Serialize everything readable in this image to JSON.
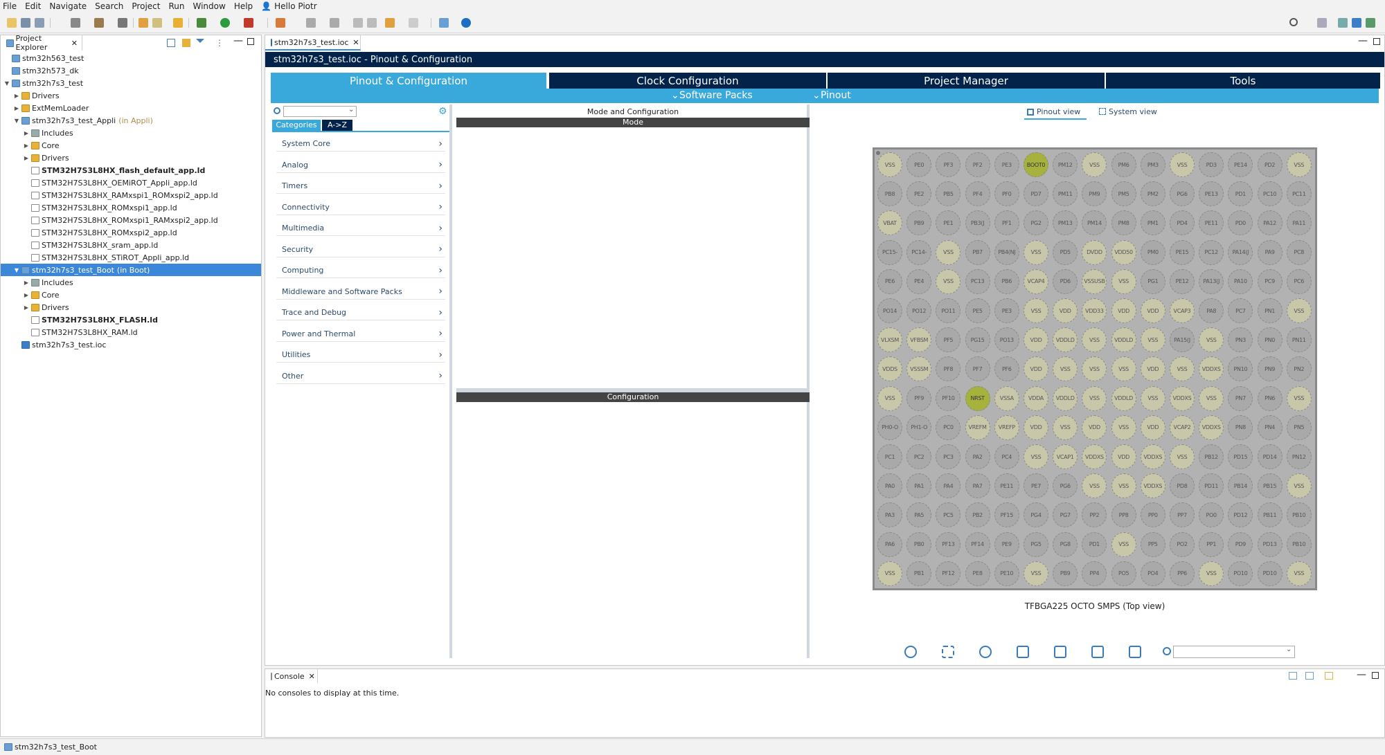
{
  "menu": [
    "File",
    "Edit",
    "Navigate",
    "Search",
    "Project",
    "Run",
    "Window",
    "Help",
    "Hello Piotr"
  ],
  "project_explorer": {
    "tab_label": "Project Explorer",
    "tree": [
      {
        "label": "stm32h563_test",
        "decor": "",
        "bold": false
      },
      {
        "label": "stm32h573_dk",
        "decor": "",
        "bold": false
      },
      {
        "label": "stm32h7s3_test",
        "decor": "",
        "bold": false
      },
      {
        "label": "Drivers",
        "decor": "",
        "bold": false
      },
      {
        "label": "ExtMemLoader",
        "decor": "",
        "bold": false
      },
      {
        "label": "stm32h7s3_test_Appli",
        "decor": "(in Appli)",
        "bold": false
      },
      {
        "label": "Includes",
        "decor": "",
        "bold": false
      },
      {
        "label": "Core",
        "decor": "",
        "bold": false
      },
      {
        "label": "Drivers",
        "decor": "",
        "bold": false
      },
      {
        "label": "STM32H7S3L8HX_flash_default_app.ld",
        "decor": "",
        "bold": true
      },
      {
        "label": "STM32H7S3L8HX_OEMiROT_Appli_app.ld",
        "decor": "",
        "bold": false
      },
      {
        "label": "STM32H7S3L8HX_RAMxspi1_ROMxspi2_app.ld",
        "decor": "",
        "bold": false
      },
      {
        "label": "STM32H7S3L8HX_ROMxspi1_app.ld",
        "decor": "",
        "bold": false
      },
      {
        "label": "STM32H7S3L8HX_ROMxspi1_RAMxspi2_app.ld",
        "decor": "",
        "bold": false
      },
      {
        "label": "STM32H7S3L8HX_ROMxspi2_app.ld",
        "decor": "",
        "bold": false
      },
      {
        "label": "STM32H7S3L8HX_sram_app.ld",
        "decor": "",
        "bold": false
      },
      {
        "label": "STM32H7S3L8HX_STiROT_Appli_app.ld",
        "decor": "",
        "bold": false
      },
      {
        "label": "stm32h7s3_test_Boot",
        "decor": "(in Boot)",
        "bold": false
      },
      {
        "label": "Includes",
        "decor": "",
        "bold": false
      },
      {
        "label": "Core",
        "decor": "",
        "bold": false
      },
      {
        "label": "Drivers",
        "decor": "",
        "bold": false
      },
      {
        "label": "STM32H7S3L8HX_FLASH.ld",
        "decor": "",
        "bold": true
      },
      {
        "label": "STM32H7S3L8HX_RAM.ld",
        "decor": "",
        "bold": false
      },
      {
        "label": "stm32h7s3_test.ioc",
        "decor": "",
        "bold": false
      }
    ]
  },
  "editor": {
    "tab_label": "stm32h7s3_test.ioc",
    "banner": "stm32h7s3_test.ioc - Pinout & Configuration",
    "main_tabs": [
      "Pinout & Configuration",
      "Clock Configuration",
      "Project Manager",
      "Tools"
    ],
    "sub_menus": [
      "Software Packs",
      "Pinout"
    ],
    "cat_tabs": [
      "Categories",
      "A->Z"
    ],
    "categories": [
      "System Core",
      "Analog",
      "Timers",
      "Connectivity",
      "Multimedia",
      "Security",
      "Computing",
      "Middleware and Software Packs",
      "Trace and Debug",
      "Power and Thermal",
      "Utilities",
      "Other"
    ],
    "mode_title": "Mode and Configuration",
    "mode_header": "Mode",
    "config_header": "Configuration",
    "view_tabs": [
      "Pinout view",
      "System view"
    ],
    "package_label": "TFBGA225 OCTO SMPS (Top view)"
  },
  "pins": [
    [
      "VSS",
      "PE0",
      "PF3",
      "PF2",
      "PE3",
      "BOOT0",
      "PM12",
      "VSS",
      "PM6",
      "PM3",
      "VSS",
      "PD3",
      "PE14",
      "PD2",
      "VSS"
    ],
    [
      "PB8",
      "PE2",
      "PB5",
      "PF4",
      "PF0",
      "PD7",
      "PM11",
      "PM9",
      "PM5",
      "PM2",
      "PG6",
      "PE13",
      "PD1",
      "PC10",
      "PC11"
    ],
    [
      "VBAT",
      "PB9",
      "PE1",
      "PB3(J",
      "PF1",
      "PG2",
      "PM13",
      "PM14",
      "PM8",
      "PM1",
      "PD4",
      "PE11",
      "PD0",
      "PA12",
      "PA11"
    ],
    [
      "PC15-",
      "PC14-",
      "VSS",
      "PB7",
      "PB4(NJ",
      "VSS",
      "PD5",
      "DVDD",
      "VDD50",
      "PM0",
      "PE15",
      "PC12",
      "PA14(J",
      "PA9",
      "PC8"
    ],
    [
      "PE6",
      "PE4",
      "VSS",
      "PC13",
      "PB6",
      "VCAP4",
      "PD6",
      "VSSUSB",
      "VSS",
      "PG1",
      "PE12",
      "PA13(J",
      "PA10",
      "PC9",
      "PC6"
    ],
    [
      "PO14",
      "PO12",
      "PO11",
      "PE5",
      "PE3",
      "VSS",
      "VDD",
      "VDD33",
      "VDD",
      "VDD",
      "VCAP3",
      "PA8",
      "PC7",
      "PN1",
      "VSS"
    ],
    [
      "VLXSM",
      "VFBSM",
      "PF5",
      "PG15",
      "PO13",
      "VDD",
      "VDDLD",
      "VSS",
      "VDDLD",
      "VSS",
      "PA15(J",
      "VSS",
      "PN3",
      "PN0",
      "PN11"
    ],
    [
      "VDDS",
      "VSSSM",
      "PF8",
      "PF7",
      "PF6",
      "VDD",
      "VSS",
      "VSS",
      "VSS",
      "VDD",
      "VSS",
      "VDDXS",
      "PN10",
      "PN9",
      "PN2"
    ],
    [
      "VSS",
      "PF9",
      "PF10",
      "NRST",
      "VSSA",
      "VDDA",
      "VDDLD",
      "VSS",
      "VDDLD",
      "VSS",
      "VDDXS",
      "VSS",
      "PN7",
      "PN6",
      "VSS"
    ],
    [
      "PH0-O",
      "PH1-O",
      "PC0",
      "VREFM",
      "VREFP",
      "VDD",
      "VSS",
      "VDD",
      "VSS",
      "VDD",
      "VCAP2",
      "VDDXS",
      "PN8",
      "PN4",
      "PN5"
    ],
    [
      "PC1",
      "PC2",
      "PC3",
      "PA2",
      "PC4",
      "VSS",
      "VCAP1",
      "VDDXS",
      "VDD",
      "VDDXS",
      "VSS",
      "PB12",
      "PD15",
      "PD14",
      "PN12"
    ],
    [
      "PA0",
      "PA1",
      "PA4",
      "PA7",
      "PE11",
      "PE7",
      "PG6",
      "VSS",
      "VSS",
      "VDDXS",
      "PD8",
      "PD11",
      "PB14",
      "PB15",
      "VSS"
    ],
    [
      "PA3",
      "PA5",
      "PC5",
      "PB2",
      "PF15",
      "PG4",
      "PG7",
      "PP2",
      "PP8",
      "PP0",
      "PP7",
      "PO0",
      "PD12",
      "PB11",
      "PB10"
    ],
    [
      "PA6",
      "PB0",
      "PF13",
      "PF14",
      "PE9",
      "PG5",
      "PG8",
      "PD1",
      "VSS",
      "PP5",
      "PO2",
      "PP1",
      "PD9",
      "PD13",
      "PB10"
    ],
    [
      "VSS",
      "PB1",
      "PF12",
      "PE8",
      "PE10",
      "VSS",
      "PB9",
      "PP4",
      "PO5",
      "PO4",
      "PP6",
      "VSS",
      "PO10",
      "PD10",
      "VSS"
    ]
  ],
  "selected_pins": [
    "BOOT0",
    "NRST"
  ],
  "console": {
    "tab_label": "Console",
    "message": "No consoles to display at this time."
  },
  "status": {
    "text": "stm32h7s3_test_Boot"
  },
  "colors": {
    "accent": "#39a9dc",
    "navy": "#03234b",
    "selection": "#3b87d9",
    "pin_selected": "#a6b23c"
  }
}
